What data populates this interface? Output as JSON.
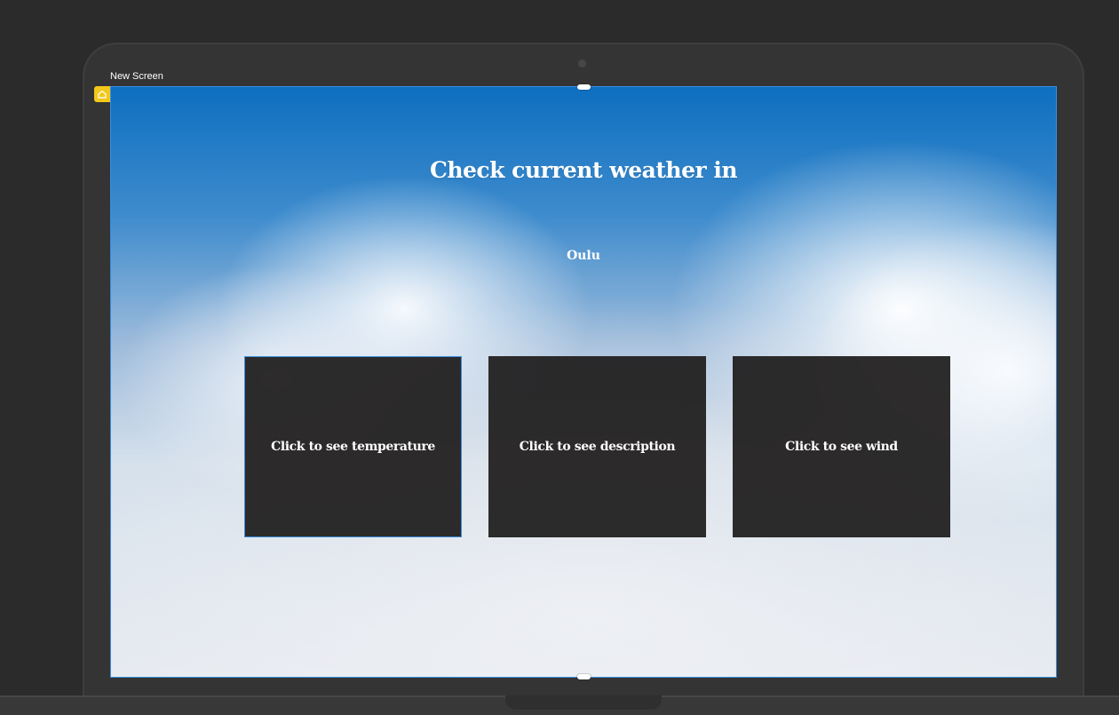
{
  "editor": {
    "screen_name": "New Screen",
    "home_icon": "home-icon"
  },
  "app": {
    "title": "Check current weather in",
    "city": "Oulu",
    "cards": [
      {
        "label": "Click to see temperature"
      },
      {
        "label": "Click to see description"
      },
      {
        "label": "Click to see wind"
      }
    ]
  },
  "colors": {
    "selection": "#3b8fe0",
    "home_badge": "#f2c81b",
    "card_bg": "#1e1c1c",
    "text": "#ffffff"
  }
}
